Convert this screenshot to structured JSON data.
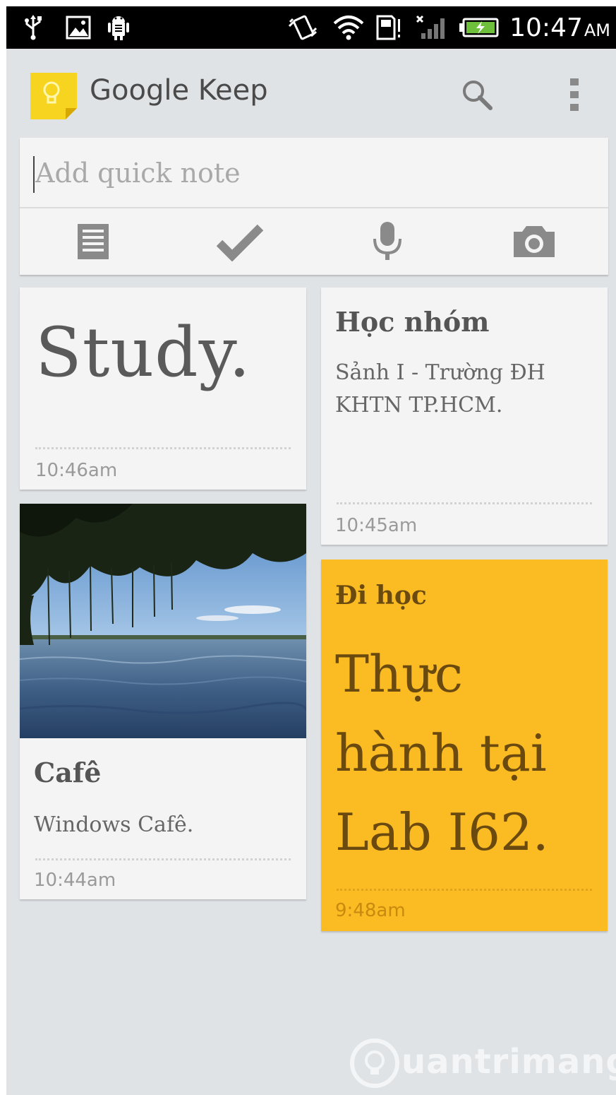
{
  "status_bar": {
    "time": "10:47",
    "ampm": "AM",
    "left_icons": [
      "usb-icon",
      "image-notification-icon",
      "android-debug-icon"
    ],
    "right_icons": [
      "vibrate-icon",
      "wifi-icon",
      "sd-card-icon",
      "no-signal-icon",
      "battery-charging-icon"
    ]
  },
  "app_bar": {
    "title": "Google Keep",
    "actions": [
      "search-icon",
      "overflow-menu-icon"
    ]
  },
  "quick_note": {
    "placeholder": "Add quick note",
    "tools": [
      "text-note-icon",
      "checklist-icon",
      "microphone-icon",
      "camera-icon"
    ]
  },
  "notes": [
    {
      "body": "Study.",
      "time": "10:46am",
      "color": "#f4f4f4"
    },
    {
      "title": "Học nhóm",
      "body": "Sảnh I - Trường ĐH KHTN TP.HCM.",
      "time": "10:45am",
      "color": "#f4f4f4"
    },
    {
      "image": "lake-photo",
      "title": "Cafê",
      "body": "Windows Cafê.",
      "time": "10:44am",
      "color": "#f4f4f4"
    },
    {
      "title": "Đi học",
      "body": "Thực hành tại Lab I62.",
      "time": "9:48am",
      "color": "#fbbb22"
    }
  ],
  "watermark": {
    "text": "uantrimang"
  },
  "colors": {
    "background": "#dfe3e6",
    "card": "#f4f4f4",
    "yellow_note": "#fbbb22",
    "status_bar": "#000000"
  }
}
